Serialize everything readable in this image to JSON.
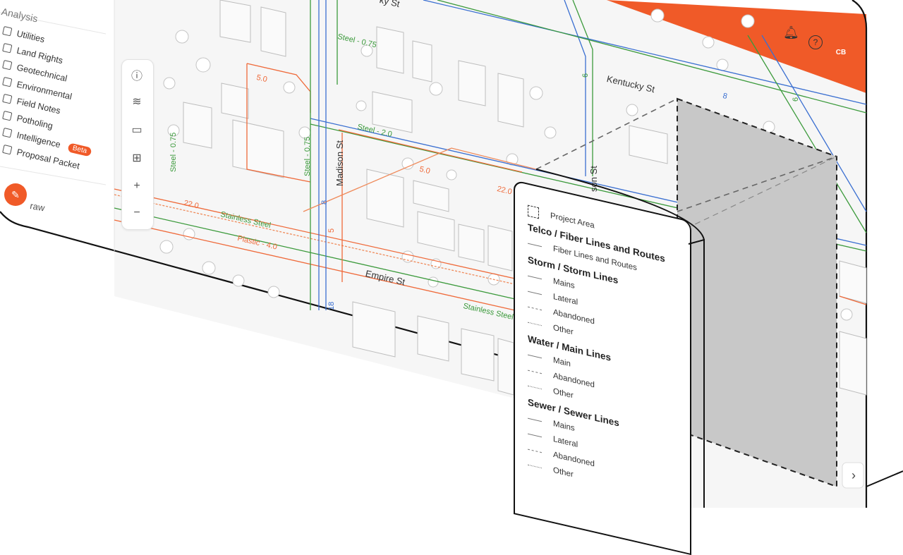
{
  "sidebar": {
    "section_title": "Analysis",
    "items": [
      {
        "label": "Utilities",
        "icon": "utilities-icon"
      },
      {
        "label": "Land Rights",
        "icon": "land-rights-icon"
      },
      {
        "label": "Geotechnical",
        "icon": "geotechnical-icon"
      },
      {
        "label": "Environmental",
        "icon": "environmental-icon"
      },
      {
        "label": "Field Notes",
        "icon": "field-notes-icon"
      },
      {
        "label": "Potholing",
        "icon": "potholing-icon"
      },
      {
        "label": "Intelligence",
        "icon": "intelligence-icon",
        "badge": "Beta"
      },
      {
        "label": "Proposal Packet",
        "icon": "proposal-packet-icon"
      }
    ],
    "brand": "raw"
  },
  "header": {
    "avatar_initials": "CB",
    "accent": "#f05a28"
  },
  "map": {
    "streets": {
      "kentucky": "Kentucky St",
      "madison": "Madison St",
      "empire": "Empire St",
      "top_partial": "ky St",
      "right_partial": "son St"
    },
    "pipe_labels": {
      "steel_075_top": "Steel - 0.75",
      "steel_075_left": "Steel - 0.75",
      "steel_075_mid": "Steel - 0.75",
      "steel_20": "Steel - 2.0",
      "stainless_1": "Stainless Steel",
      "stainless_2": "Stainless Steel",
      "plastic_40": "Plastic - 4.0",
      "v_50_a": "5.0",
      "v_50_b": "5.0",
      "v_220_a": "22.0",
      "v_220_b": "22.0",
      "v_5": "5",
      "v_18": "18",
      "v_8": "8",
      "v_6": "6",
      "v_8_side": "8",
      "v_6_top": "6"
    },
    "colors": {
      "water": "#3c9a3c",
      "sewer": "#ef6a3a",
      "telco": "#3a6fd1",
      "project_area": "#c8c8c8"
    }
  },
  "legend": {
    "project_area": "Project Area",
    "groups": [
      {
        "title": "Telco / Fiber Lines and Routes",
        "items": [
          {
            "label": "Fiber Lines and Routes",
            "style": "solid"
          }
        ]
      },
      {
        "title": "Storm / Storm Lines",
        "items": [
          {
            "label": "Mains",
            "style": "solid"
          },
          {
            "label": "Lateral",
            "style": "solid"
          },
          {
            "label": "Abandoned",
            "style": "dash"
          },
          {
            "label": "Other",
            "style": "dot"
          }
        ]
      },
      {
        "title": "Water / Main Lines",
        "items": [
          {
            "label": "Main",
            "style": "solid"
          },
          {
            "label": "Abandoned",
            "style": "dash"
          },
          {
            "label": "Other",
            "style": "dot"
          }
        ]
      },
      {
        "title": "Sewer / Sewer Lines",
        "items": [
          {
            "label": "Mains",
            "style": "solid"
          },
          {
            "label": "Lateral",
            "style": "solid"
          },
          {
            "label": "Abandoned",
            "style": "dash"
          },
          {
            "label": "Other",
            "style": "dot"
          }
        ]
      }
    ]
  },
  "toolbar": {
    "zoom_in": "+",
    "zoom_out": "−"
  },
  "pager": {
    "next": "›"
  }
}
